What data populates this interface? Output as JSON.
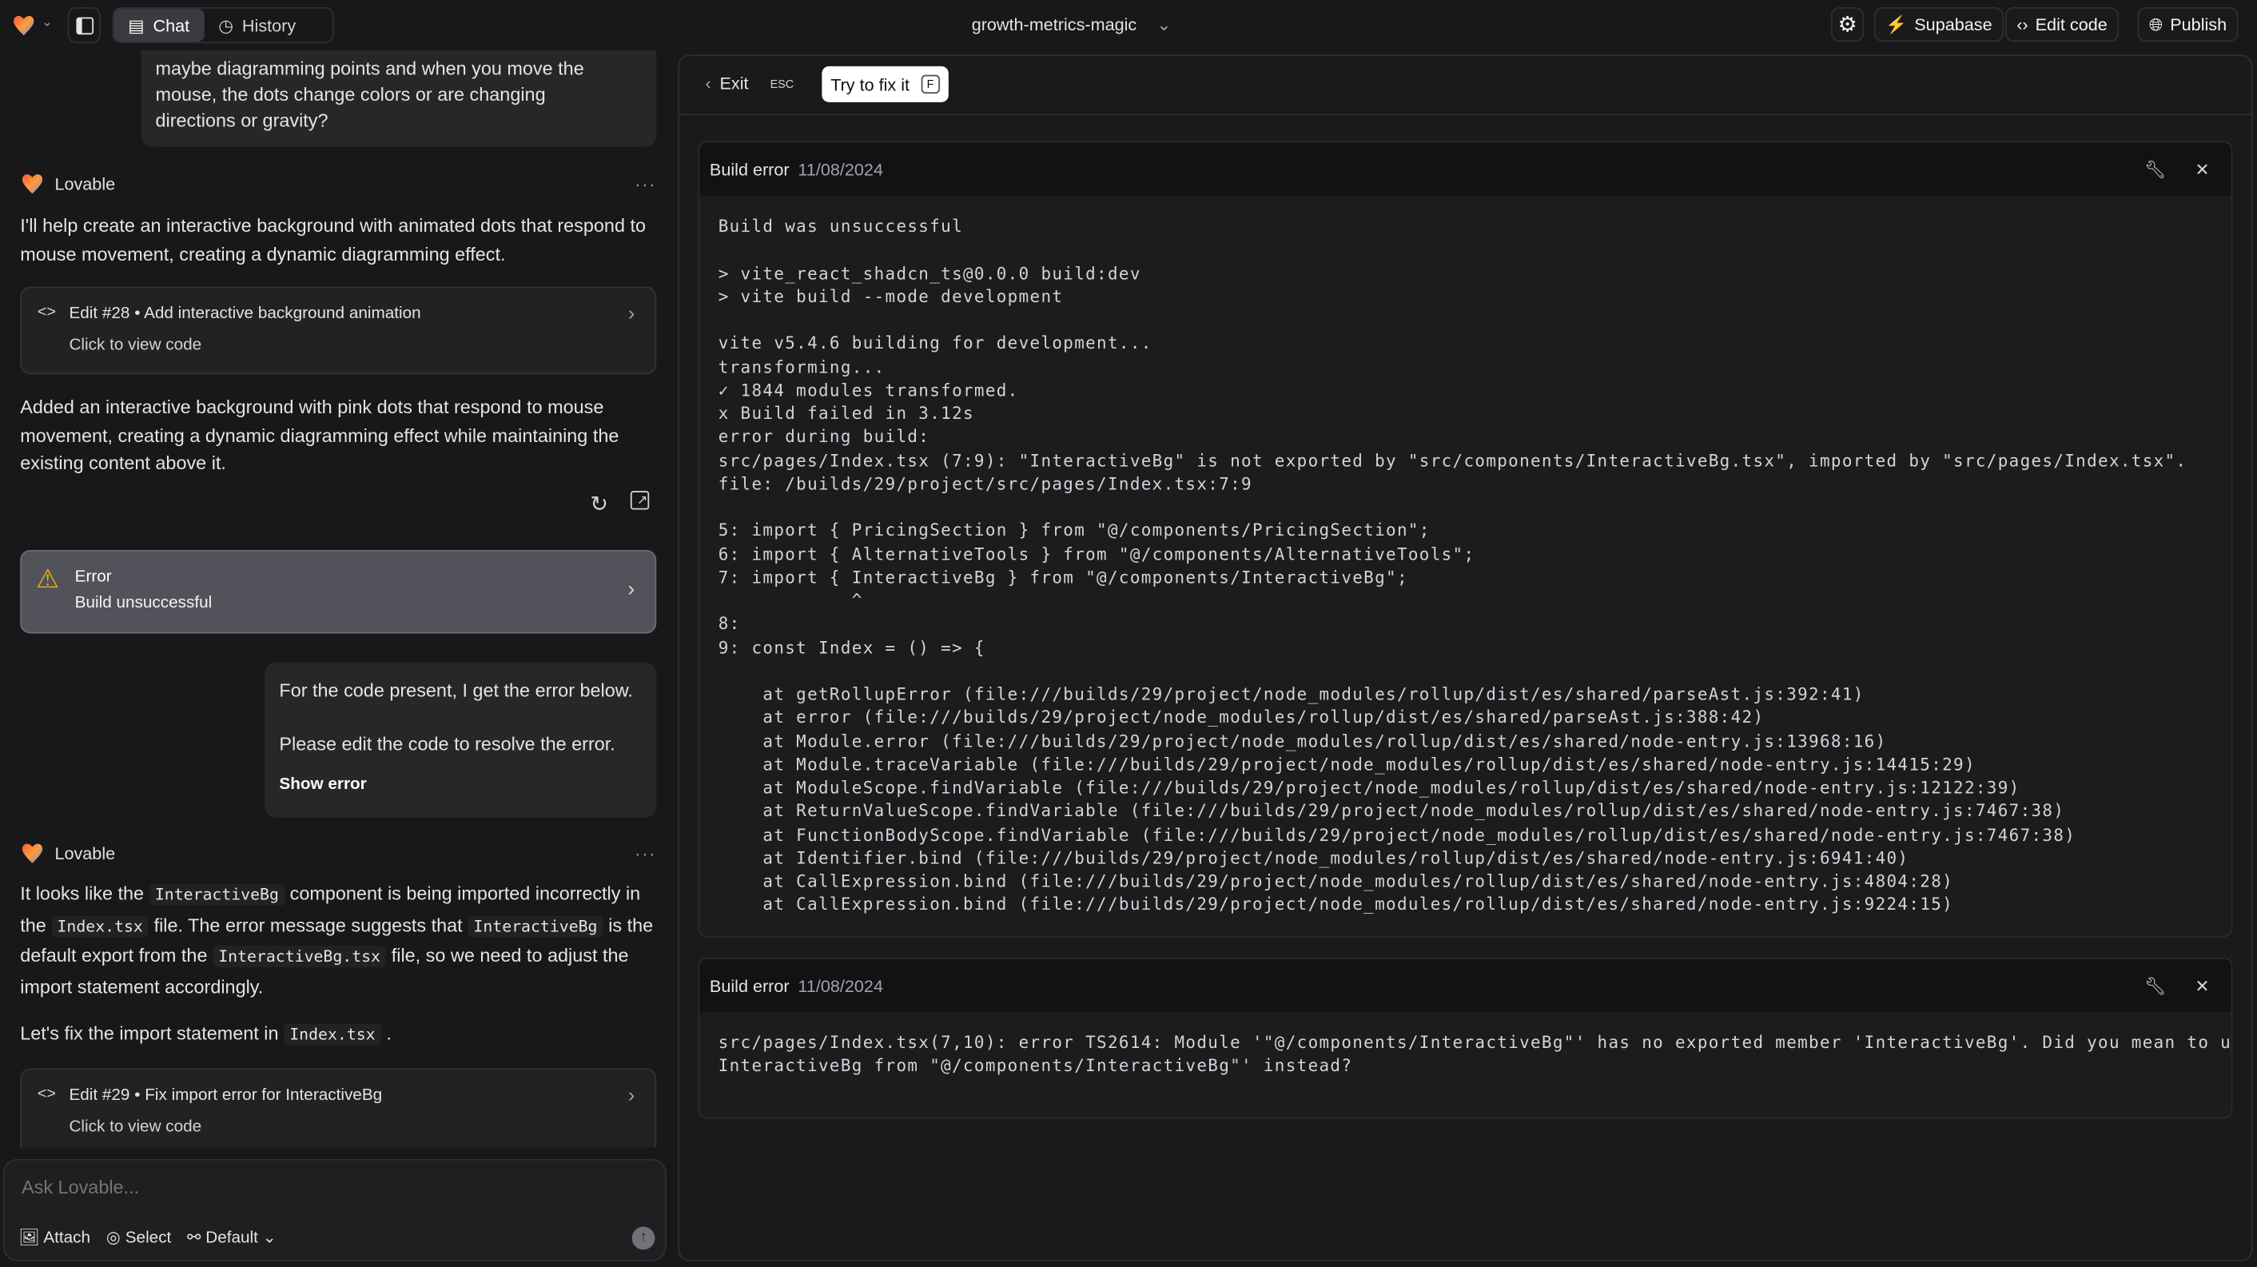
{
  "topbar": {
    "chat_tab": "Chat",
    "history_tab": "History",
    "project_name": "growth-metrics-magic",
    "supabase": "Supabase",
    "edit_code": "Edit code",
    "publish": "Publish",
    "supabase_color": "#3ecf8e"
  },
  "chat": {
    "user_msg_1": [
      "maybe diagramming points and when you move the",
      "mouse, the dots change colors or are changing",
      "directions or gravity?"
    ],
    "assistant_name": "Lovable",
    "more": "···",
    "reply_1": "I'll help create an interactive background with animated dots that respond to mouse movement, creating a dynamic diagramming effect.",
    "edit_28": {
      "title": "Edit #28 • Add interactive background animation",
      "subtitle": "Click to view code"
    },
    "reply_2": "Added an interactive background with pink dots that respond to mouse movement, creating a dynamic diagramming effect while maintaining the existing content above it.",
    "error_card": {
      "title": "Error",
      "subtitle": "Build unsuccessful",
      "warn_color": "#eab308"
    },
    "user_msg_2": {
      "line1": "For the code present, I get the error below.",
      "line2": "Please edit the code to resolve the error.",
      "link": "Show error"
    },
    "reply_3": {
      "p1a": "It looks like the",
      "c1": "InteractiveBg",
      "p1b": "component is being imported incorrectly in the",
      "c2": "Index.tsx",
      "p1c": "file. The error message suggests that",
      "c3": "InteractiveBg",
      "p1d": "is the default export from the",
      "c4": "InteractiveBg.tsx",
      "p1e": "file, so we need to adjust the import statement accordingly.",
      "p2a": "Let's fix the import statement in",
      "c5": "Index.tsx",
      "p2b": "."
    },
    "edit_29": {
      "title": "Edit #29 • Fix import error for InteractiveBg",
      "subtitle": "Click to view code"
    },
    "input": {
      "placeholder": "Ask Lovable...",
      "attach": "Attach",
      "select": "Select",
      "mode": "Default"
    }
  },
  "panel": {
    "exit": "Exit",
    "exit_key": "ESC",
    "fix": "Try to fix it",
    "fix_key": "F",
    "errors": [
      {
        "title": "Build error",
        "date": "11/08/2024",
        "log": "Build was unsuccessful\n\n> vite_react_shadcn_ts@0.0.0 build:dev\n> vite build --mode development\n\nvite v5.4.6 building for development...\ntransforming...\n✓ 1844 modules transformed.\nx Build failed in 3.12s\nerror during build:\nsrc/pages/Index.tsx (7:9): \"InteractiveBg\" is not exported by \"src/components/InteractiveBg.tsx\", imported by \"src/pages/Index.tsx\".\nfile: /builds/29/project/src/pages/Index.tsx:7:9\n\n5: import { PricingSection } from \"@/components/PricingSection\";\n6: import { AlternativeTools } from \"@/components/AlternativeTools\";\n7: import { InteractiveBg } from \"@/components/InteractiveBg\";\n            ^\n8:\n9: const Index = () => {\n\n    at getRollupError (file:///builds/29/project/node_modules/rollup/dist/es/shared/parseAst.js:392:41)\n    at error (file:///builds/29/project/node_modules/rollup/dist/es/shared/parseAst.js:388:42)\n    at Module.error (file:///builds/29/project/node_modules/rollup/dist/es/shared/node-entry.js:13968:16)\n    at Module.traceVariable (file:///builds/29/project/node_modules/rollup/dist/es/shared/node-entry.js:14415:29)\n    at ModuleScope.findVariable (file:///builds/29/project/node_modules/rollup/dist/es/shared/node-entry.js:12122:39)\n    at ReturnValueScope.findVariable (file:///builds/29/project/node_modules/rollup/dist/es/shared/node-entry.js:7467:38)\n    at FunctionBodyScope.findVariable (file:///builds/29/project/node_modules/rollup/dist/es/shared/node-entry.js:7467:38)\n    at Identifier.bind (file:///builds/29/project/node_modules/rollup/dist/es/shared/node-entry.js:6941:40)\n    at CallExpression.bind (file:///builds/29/project/node_modules/rollup/dist/es/shared/node-entry.js:4804:28)\n    at CallExpression.bind (file:///builds/29/project/node_modules/rollup/dist/es/shared/node-entry.js:9224:15)"
      },
      {
        "title": "Build error",
        "date": "11/08/2024",
        "log": "src/pages/Index.tsx(7,10): error TS2614: Module '\"@/components/InteractiveBg\"' has no exported member 'InteractiveBg'. Did you mean to use 'import\nInteractiveBg from \"@/components/InteractiveBg\"' instead?"
      }
    ]
  }
}
